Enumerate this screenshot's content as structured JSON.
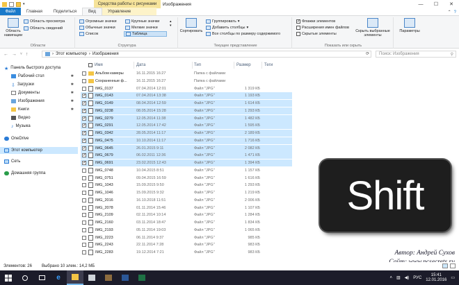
{
  "window": {
    "contextual_title": "Средства работы с рисунками",
    "title": "Изображения",
    "minimize": "—",
    "maximize": "☐",
    "close": "✕"
  },
  "ribbon": {
    "tabs": [
      "Файл",
      "Главная",
      "Поделиться",
      "Вид",
      "Управление"
    ],
    "groups": {
      "areas": {
        "label": "Области",
        "nav_pane": "Область\nнавигации",
        "preview": "Область просмотра",
        "details": "Область сведений"
      },
      "structure": {
        "label": "Структура",
        "items": [
          "Огромные значки",
          "Крупные значки",
          "Обычные значки",
          "Мелкие значки",
          "Список",
          "Таблица"
        ]
      },
      "current_view": {
        "label": "Текущее представление",
        "sort": "Сортировать",
        "group_by": "Группировать",
        "add_columns": "Добавить столбцы",
        "fit_columns": "Все столбцы по размеру содержимого"
      },
      "show_hide": {
        "label": "Показать или скрыть",
        "checkboxes": "Флажки элементов",
        "extensions": "Расширения имен файлов",
        "hidden": "Скрытые элементы",
        "hide_selected": "Скрыть выбранные\nэлементы"
      },
      "options": {
        "label": "Параметры"
      }
    }
  },
  "addressbar": {
    "path": [
      "Этот компьютер",
      "Изображения"
    ],
    "search_placeholder": "Поиск: Изображения"
  },
  "navpane": {
    "items": [
      {
        "label": "Панель быстрого доступа",
        "pinned": false
      },
      {
        "label": "Рабочий стол",
        "pinned": true
      },
      {
        "label": "Загрузки",
        "pinned": true
      },
      {
        "label": "Документы",
        "pinned": true
      },
      {
        "label": "Изображения",
        "pinned": true
      },
      {
        "label": "Книги",
        "pinned": true
      },
      {
        "label": "Видео",
        "pinned": false
      },
      {
        "label": "Музыка",
        "pinned": false
      },
      {
        "label": "OneDrive",
        "pinned": false
      },
      {
        "label": "Этот компьютер",
        "pinned": false
      },
      {
        "label": "Сеть",
        "pinned": false
      },
      {
        "label": "Домашняя группа",
        "pinned": false
      }
    ],
    "selected": "Этот компьютер"
  },
  "filelist": {
    "columns": [
      "Имя",
      "Дата",
      "Тип",
      "Размер",
      "Теги"
    ],
    "rows": [
      {
        "name": "Альбом камеры",
        "date": "16.11.2015 16:27",
        "type": "Папка с файлами",
        "size": "",
        "folder": true,
        "selected": false
      },
      {
        "name": "Сохраненные ф...",
        "date": "16.11.2015 16:27",
        "type": "Папка с файлами",
        "size": "",
        "folder": true,
        "selected": false
      },
      {
        "name": "IMG_0137",
        "date": "07.04.2014 12:01",
        "type": "Файл \"JPG\"",
        "size": "1 319 КБ",
        "folder": false,
        "selected": false
      },
      {
        "name": "IMG_0143",
        "date": "07.04.2014 13:38",
        "type": "Файл \"JPG\"",
        "size": "1 193 КБ",
        "folder": false,
        "selected": true
      },
      {
        "name": "IMG_0149",
        "date": "08.04.2014 12:59",
        "type": "Файл \"JPG\"",
        "size": "1 614 КБ",
        "folder": false,
        "selected": true
      },
      {
        "name": "IMG_0238",
        "date": "08.05.2014 15:28",
        "type": "Файл \"JPG\"",
        "size": "1 293 КБ",
        "folder": false,
        "selected": true
      },
      {
        "name": "IMG_0279",
        "date": "12.05.2014 11:38",
        "type": "Файл \"JPG\"",
        "size": "1 482 КБ",
        "folder": false,
        "selected": true
      },
      {
        "name": "IMG_0291",
        "date": "12.05.2014 17:42",
        "type": "Файл \"JPG\"",
        "size": "1 595 КБ",
        "folder": false,
        "selected": true
      },
      {
        "name": "IMG_0342",
        "date": "28.05.2014 11:17",
        "type": "Файл \"JPG\"",
        "size": "2 189 КБ",
        "folder": false,
        "selected": true
      },
      {
        "name": "IMG_0475",
        "date": "10.10.2014 11:17",
        "type": "Файл \"JPG\"",
        "size": "1 716 КБ",
        "folder": false,
        "selected": true
      },
      {
        "name": "IMG_0645",
        "date": "26.01.2015 9:11",
        "type": "Файл \"JPG\"",
        "size": "2 082 КБ",
        "folder": false,
        "selected": true
      },
      {
        "name": "IMG_0679",
        "date": "06.02.2011 12:36",
        "type": "Файл \"JPG\"",
        "size": "1 471 КБ",
        "folder": false,
        "selected": true
      },
      {
        "name": "IMG_0691",
        "date": "23.02.2015 12:43",
        "type": "Файл \"JPG\"",
        "size": "1 394 КБ",
        "folder": false,
        "selected": true
      },
      {
        "name": "IMG_0748",
        "date": "10.04.2015 8:51",
        "type": "Файл \"JPG\"",
        "size": "1 157 КБ",
        "folder": false,
        "selected": false
      },
      {
        "name": "IMG_0751",
        "date": "09.04.2015 16:59",
        "type": "Файл \"JPG\"",
        "size": "1 616 КБ",
        "folder": false,
        "selected": false
      },
      {
        "name": "IMG_1043",
        "date": "15.09.2015 9:50",
        "type": "Файл \"JPG\"",
        "size": "1 293 КБ",
        "folder": false,
        "selected": false
      },
      {
        "name": "IMG_1046",
        "date": "15.09.2015 9:32",
        "type": "Файл \"JPG\"",
        "size": "1 219 КБ",
        "folder": false,
        "selected": false
      },
      {
        "name": "IMG_2016",
        "date": "16.10.2018 11:51",
        "type": "Файл \"JPG\"",
        "size": "2 006 КБ",
        "folder": false,
        "selected": false
      },
      {
        "name": "IMG_2078",
        "date": "01.11.2014 15:46",
        "type": "Файл \"JPG\"",
        "size": "1 107 КБ",
        "folder": false,
        "selected": false
      },
      {
        "name": "IMG_2109",
        "date": "02.11.2014 10:14",
        "type": "Файл \"JPG\"",
        "size": "1 284 КБ",
        "folder": false,
        "selected": false
      },
      {
        "name": "IMG_2160",
        "date": "03.11.2014 18:47",
        "type": "Файл \"JPG\"",
        "size": "1 834 КБ",
        "folder": false,
        "selected": false
      },
      {
        "name": "IMG_2193",
        "date": "05.11.2014 19:03",
        "type": "Файл \"JPG\"",
        "size": "1 065 КБ",
        "folder": false,
        "selected": false
      },
      {
        "name": "IMG_2223",
        "date": "06.11.2014 9:37",
        "type": "Файл \"JPG\"",
        "size": "985 КБ",
        "folder": false,
        "selected": false
      },
      {
        "name": "IMG_2243",
        "date": "22.11.2014 7:28",
        "type": "Файл \"JPG\"",
        "size": "983 КБ",
        "folder": false,
        "selected": false
      },
      {
        "name": "IMG_2283",
        "date": "19.12.2014 7:21",
        "type": "Файл \"JPG\"",
        "size": "983 КБ",
        "folder": false,
        "selected": false
      }
    ]
  },
  "overlay": {
    "key_label": "Shift",
    "author_line": "Автор: Андрей Сухов",
    "site_line": "Сайт: www.pcsecrets.ru"
  },
  "statusbar": {
    "count": "Элементов: 26",
    "selection": "Выбрано 10 элем.: 14,2 МБ"
  },
  "taskbar": {
    "lang": "РУС",
    "time": "15:41",
    "date": "12.01.2016"
  },
  "colors": {
    "selection": "#cce8ff",
    "file_tab": "#1979ca",
    "context_tab": "#f6e39a",
    "taskbar": "#1c1c2a"
  }
}
